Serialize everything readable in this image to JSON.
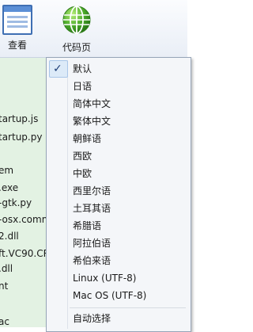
{
  "toolbar": {
    "view_label": "查看",
    "codepage_label": "代码页",
    "view_icon": "window-view-icon",
    "codepage_icon": "globe-icon"
  },
  "left_files": [
    "tartup.js",
    "tartup.py",
    "em",
    ".exe",
    "-gtk.py",
    "-osx.comm",
    "2.dll",
    "ft.VC90.CR",
    ".dll",
    "nt",
    "ac"
  ],
  "codepage_menu": {
    "items": [
      {
        "label": "默认",
        "checked": true
      },
      {
        "label": "日语",
        "checked": false
      },
      {
        "label": "简体中文",
        "checked": false
      },
      {
        "label": "繁体中文",
        "checked": false
      },
      {
        "label": "朝鲜语",
        "checked": false
      },
      {
        "label": "西欧",
        "checked": false
      },
      {
        "label": "中欧",
        "checked": false
      },
      {
        "label": "西里尔语",
        "checked": false
      },
      {
        "label": "土耳其语",
        "checked": false
      },
      {
        "label": "希腊语",
        "checked": false
      },
      {
        "label": "阿拉伯语",
        "checked": false
      },
      {
        "label": "希伯来语",
        "checked": false
      },
      {
        "label": "Linux (UTF-8)",
        "checked": false
      },
      {
        "label": "Mac OS (UTF-8)",
        "checked": false
      }
    ],
    "auto_select_label": "自动选择",
    "check_mark": "✓"
  }
}
